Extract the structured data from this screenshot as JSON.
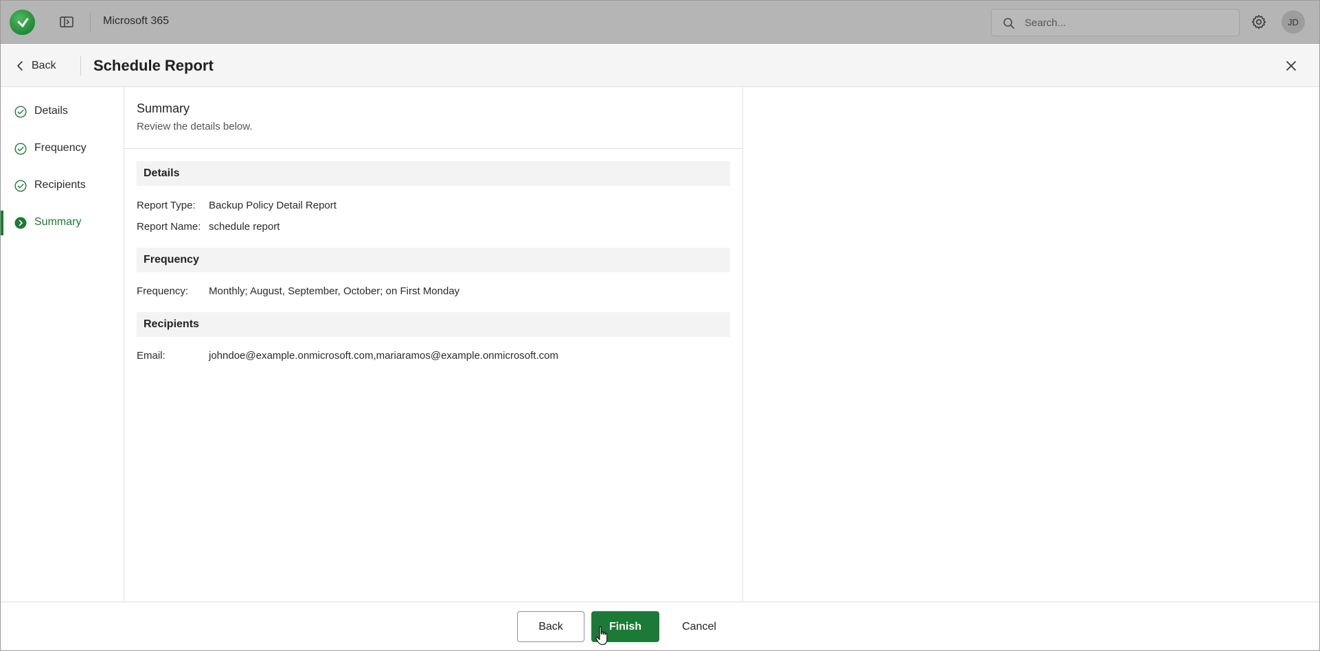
{
  "header": {
    "app_title": "Microsoft 365",
    "search": {
      "placeholder": "Search..."
    },
    "user_initials": "JD"
  },
  "wizard": {
    "back_label": "Back",
    "title": "Schedule Report"
  },
  "steps": [
    {
      "label": "Details",
      "state": "completed"
    },
    {
      "label": "Frequency",
      "state": "completed"
    },
    {
      "label": "Recipients",
      "state": "completed"
    },
    {
      "label": "Summary",
      "state": "current"
    }
  ],
  "summary": {
    "title": "Summary",
    "subtitle": "Review the details below.",
    "sections": {
      "details": {
        "heading": "Details",
        "rows": [
          {
            "key": "Report Type:",
            "value": "Backup Policy Detail Report"
          },
          {
            "key": "Report Name:",
            "value": "schedule report"
          }
        ]
      },
      "frequency": {
        "heading": "Frequency",
        "rows": [
          {
            "key": "Frequency:",
            "value": "Monthly; August, September, October; on First Monday"
          }
        ]
      },
      "recipients": {
        "heading": "Recipients",
        "rows": [
          {
            "key": "Email:",
            "value": "johndoe@example.onmicrosoft.com,mariaramos@example.onmicrosoft.com"
          }
        ]
      }
    }
  },
  "footer": {
    "back_label": "Back",
    "finish_label": "Finish",
    "cancel_label": "Cancel"
  },
  "colors": {
    "accent": "#1b7a36",
    "header_bg": "#b5b5b5",
    "section_bg": "#f3f3f3"
  }
}
